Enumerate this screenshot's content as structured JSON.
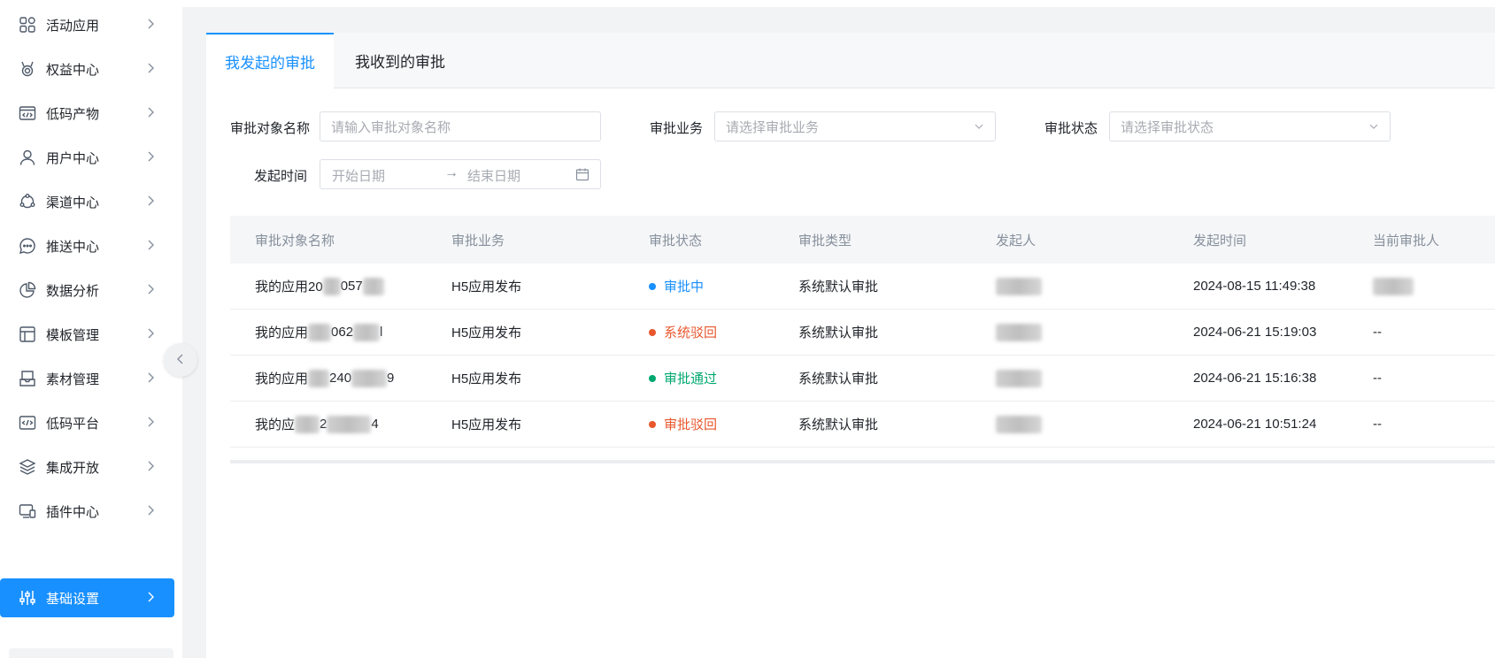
{
  "sidebar": {
    "items": [
      {
        "label": "活动应用",
        "icon": "apps-icon"
      },
      {
        "label": "权益中心",
        "icon": "medal-icon"
      },
      {
        "label": "低码产物",
        "icon": "code-window-icon"
      },
      {
        "label": "用户中心",
        "icon": "user-icon"
      },
      {
        "label": "渠道中心",
        "icon": "channel-icon"
      },
      {
        "label": "推送中心",
        "icon": "chat-bubble-icon"
      },
      {
        "label": "数据分析",
        "icon": "pie-chart-icon"
      },
      {
        "label": "模板管理",
        "icon": "layout-icon"
      },
      {
        "label": "素材管理",
        "icon": "inbox-icon"
      },
      {
        "label": "低码平台",
        "icon": "code-icon"
      },
      {
        "label": "集成开放",
        "icon": "layers-icon"
      },
      {
        "label": "插件中心",
        "icon": "monitor-icon"
      },
      {
        "label": "基础设置",
        "icon": "sliders-icon",
        "active": true
      }
    ]
  },
  "tabs": [
    {
      "label": "我发起的审批",
      "active": true
    },
    {
      "label": "我收到的审批",
      "active": false
    }
  ],
  "filters": {
    "name_label": "审批对象名称",
    "name_placeholder": "请输入审批对象名称",
    "business_label": "审批业务",
    "business_placeholder": "请选择审批业务",
    "status_label": "审批状态",
    "status_placeholder": "请选择审批状态",
    "time_label": "发起时间",
    "start_placeholder": "开始日期",
    "end_placeholder": "结束日期",
    "range_separator": "→"
  },
  "table": {
    "headers": [
      "审批对象名称",
      "审批业务",
      "审批状态",
      "审批类型",
      "发起人",
      "发起时间",
      "当前审批人"
    ],
    "rows": [
      {
        "name": "我的应用20",
        "name_tail": "057",
        "business": "H5应用发布",
        "status": "审批中",
        "status_color": "#1890ff",
        "type": "系统默认审批",
        "time": "2024-08-15 11:49:38",
        "approver": ""
      },
      {
        "name": "我的应用",
        "name_tail": "062",
        "business": "H5应用发布",
        "status": "系统驳回",
        "status_color": "#e8572e",
        "type": "系统默认审批",
        "time": "2024-06-21 15:19:03",
        "approver": "--"
      },
      {
        "name": "我的应用",
        "name_tail": "240",
        "business": "H5应用发布",
        "status": "审批通过",
        "status_color": "#00a870",
        "type": "系统默认审批",
        "time": "2024-06-21 15:16:38",
        "approver": "--"
      },
      {
        "name": "我的应",
        "name_tail": "2",
        "business": "H5应用发布",
        "status": "审批驳回",
        "status_color": "#e8572e",
        "type": "系统默认审批",
        "time": "2024-06-21 10:51:24",
        "approver": "--"
      }
    ],
    "row_suffixes": [
      "",
      "l",
      "9",
      "4"
    ]
  }
}
